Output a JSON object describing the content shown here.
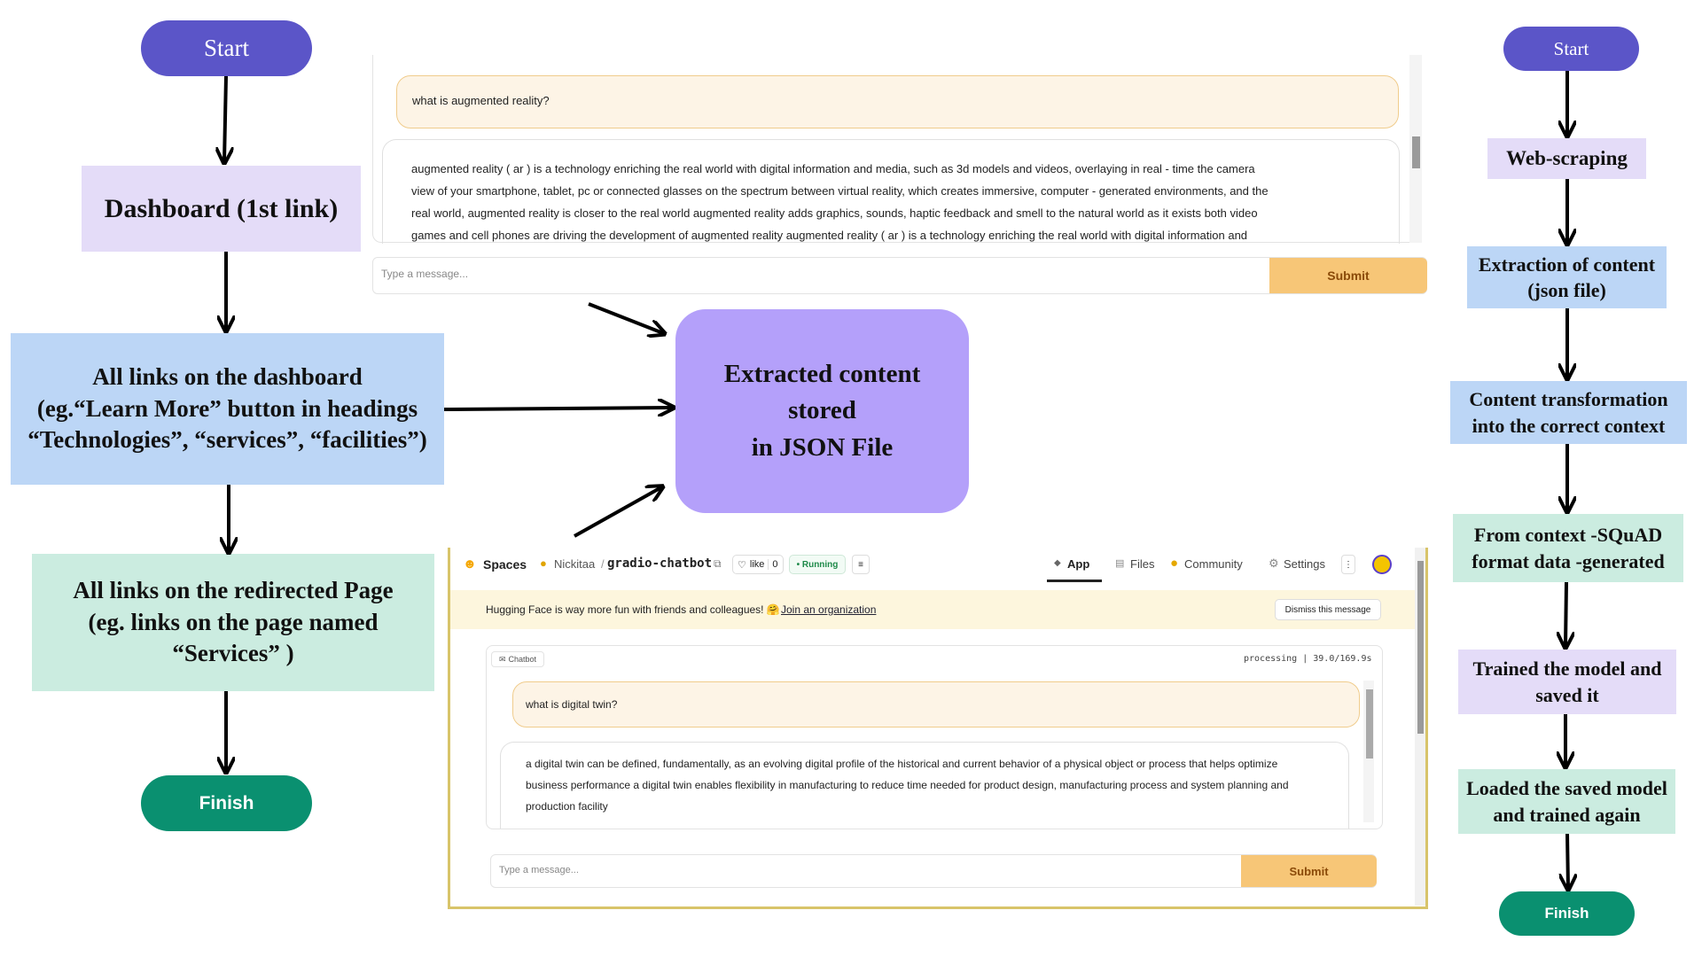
{
  "colors": {
    "start_fill": "#5b55c8",
    "finish_fill": "#0a9070",
    "lavender": "#e4dcf8",
    "light_blue": "#bcd6f6",
    "mint": "#cbece0",
    "central_fill": "#b4a0fa",
    "accent_orange": "#f7c677",
    "user_bubble": "#fdf4e6"
  },
  "left_flow": {
    "start": "Start",
    "dashboard": "Dashboard (1st link)",
    "all_links": [
      "All links on the dashboard",
      "(eg.“Learn More” button in headings",
      "“Technologies”, “services”, “facilities”)"
    ],
    "redirected": [
      "All links on the redirected Page",
      "(eg. links on the page named",
      "“Services” )"
    ],
    "finish": "Finish"
  },
  "center": {
    "lines": [
      "Extracted content",
      "stored",
      "in JSON File"
    ]
  },
  "top_chat": {
    "question": "what is augmented reality?",
    "answer_lines": [
      "augmented reality ( ar ) is a technology enriching the real world with digital information and media, such as 3d models and videos, overlaying in real - time the camera",
      "view of your smartphone, tablet, pc or connected glasses on the spectrum between virtual reality, which creates immersive, computer - generated environments, and the",
      "real world, augmented reality is closer to the real world augmented reality adds graphics, sounds, haptic feedback and smell to the natural world as it exists both video",
      "games and cell phones are driving the development of augmented reality augmented reality ( ar ) is a technology enriching the real world with digital information and"
    ],
    "input_placeholder": "Type a message...",
    "submit": "Submit"
  },
  "bottom_app": {
    "spaces": "Spaces",
    "user": "Nickitaa",
    "repo": "gradio-chatbot",
    "like": "like",
    "like_count": "0",
    "status": "Running",
    "nav": {
      "app": "App",
      "files": "Files",
      "community": "Community",
      "settings": "Settings"
    },
    "banner_text": "Hugging Face is way more fun with friends and colleagues! 🤗",
    "banner_link": "Join an organization",
    "dismiss": "Dismiss this message",
    "chatbot_label": "Chatbot",
    "processing": "processing | 39.0/169.9s",
    "question": "what is digital twin?",
    "answer_lines": [
      "a digital twin can be defined, fundamentally, as an evolving digital profile of the historical and current behavior of a physical object or process that helps optimize",
      "business performance a digital twin enables flexibility in manufacturing to reduce time needed for product design, manufacturing process and system planning and",
      "production facility"
    ],
    "input_placeholder": "Type a message...",
    "submit": "Submit"
  },
  "right_flow": {
    "start": "Start",
    "web_scraping": "Web-scraping",
    "extraction": [
      "Extraction of content",
      "(json file)"
    ],
    "transformation": [
      "Content transformation",
      "into the correct context"
    ],
    "squad": [
      "From context -SQuAD",
      "format data -generated"
    ],
    "trained": [
      "Trained the model and",
      "saved it"
    ],
    "loaded": [
      "Loaded the saved model",
      "and trained again"
    ],
    "finish": "Finish"
  }
}
